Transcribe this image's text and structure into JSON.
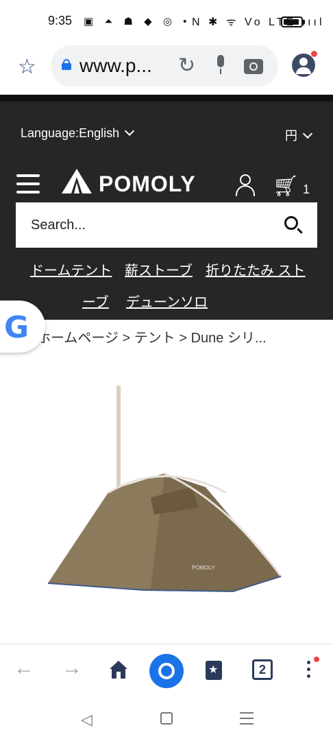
{
  "status_bar": {
    "time": "9:35",
    "left_icons": "▣ ⏶ ☗ ◆ ◎ •",
    "right_icons": "N ✱ ᯤ Vo LTE ıııl"
  },
  "browser": {
    "url": "www.p...",
    "icons": [
      "star-icon",
      "lock-icon",
      "reload-icon",
      "mic-icon",
      "camera-icon",
      "account-icon"
    ]
  },
  "site": {
    "language_label": "Language:English",
    "currency_label": "円",
    "brand": "POMOLY",
    "cart_count": "1",
    "search_placeholder": "Search...",
    "nav_links": [
      "ドームテント",
      "薪ストーブ",
      "折りたたみ スト",
      "ーブ",
      "デューンソロ"
    ]
  },
  "breadcrumb": "ホームページ > テント >  Dune シリ...",
  "bottom_bar": {
    "tab_count": "2"
  },
  "colors": {
    "header_bg": "#262626",
    "accent_blue": "#1a73e8",
    "tent_color": "#7c6a4e"
  }
}
